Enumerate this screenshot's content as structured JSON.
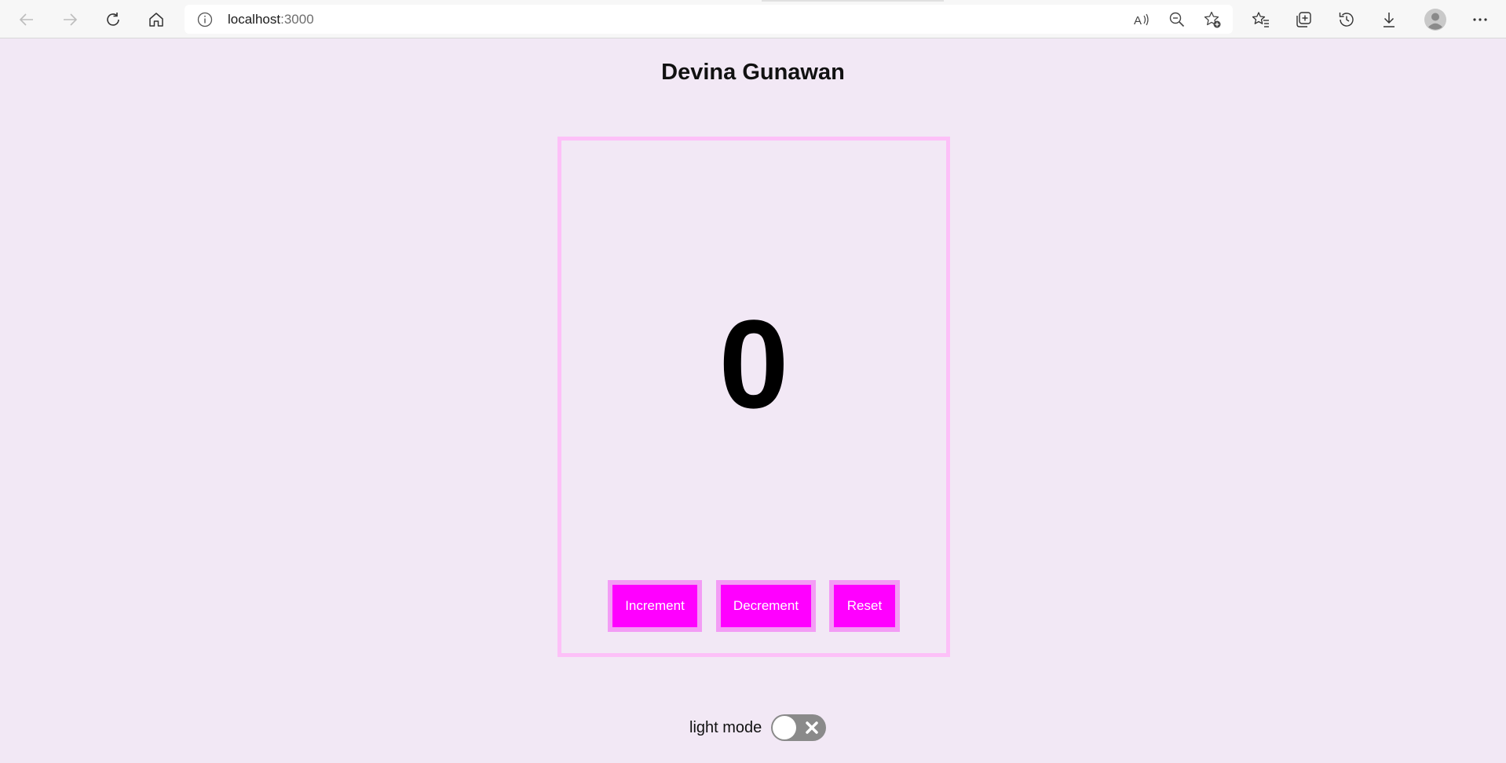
{
  "browser": {
    "url_host": "localhost",
    "url_port": ":3000",
    "icons": {
      "back": "back-arrow-icon",
      "forward": "forward-arrow-icon",
      "refresh": "refresh-icon",
      "home": "home-icon",
      "site_info": "info-icon",
      "read_aloud": "read-aloud-icon",
      "zoom": "zoom-out-icon",
      "add_favorite": "add-favorite-icon",
      "favorites": "favorites-icon",
      "collections": "collections-icon",
      "history": "history-icon",
      "downloads": "download-icon",
      "profile": "profile-avatar",
      "more": "more-icon"
    }
  },
  "page": {
    "title": "Devina Gunawan",
    "background": "#f2e8f5"
  },
  "counter": {
    "value": "0",
    "border_color": "#fdc0f8",
    "buttons": {
      "increment": "Increment",
      "decrement": "Decrement",
      "reset": "Reset"
    },
    "button_color": "#ff00ff",
    "button_border_color": "#f39cf5"
  },
  "theme_toggle": {
    "label": "light mode",
    "state": "off",
    "icon": "close-icon"
  }
}
